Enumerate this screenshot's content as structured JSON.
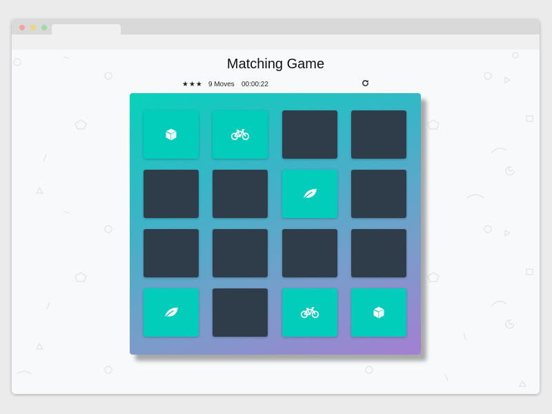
{
  "title": "Matching Game",
  "score": {
    "stars": "★★★",
    "moves": "9 Moves",
    "timer": "00:00:22"
  },
  "restart_icon": "refresh-icon",
  "colors": {
    "card_closed": "#2e3d49",
    "card_open": "#02ccba",
    "deck_gradient_start": "#06d2bb",
    "deck_gradient_end": "#a47fd1"
  },
  "deck": [
    {
      "icon": "cube-icon",
      "state": "open"
    },
    {
      "icon": "bicycle-icon",
      "state": "open"
    },
    {
      "icon": "",
      "state": "closed"
    },
    {
      "icon": "",
      "state": "closed"
    },
    {
      "icon": "",
      "state": "closed"
    },
    {
      "icon": "",
      "state": "closed"
    },
    {
      "icon": "leaf-icon",
      "state": "open"
    },
    {
      "icon": "",
      "state": "closed"
    },
    {
      "icon": "",
      "state": "closed"
    },
    {
      "icon": "",
      "state": "closed"
    },
    {
      "icon": "",
      "state": "closed"
    },
    {
      "icon": "",
      "state": "closed"
    },
    {
      "icon": "leaf-icon",
      "state": "open"
    },
    {
      "icon": "",
      "state": "closed"
    },
    {
      "icon": "bicycle-icon",
      "state": "open"
    },
    {
      "icon": "cube-icon",
      "state": "open"
    }
  ]
}
